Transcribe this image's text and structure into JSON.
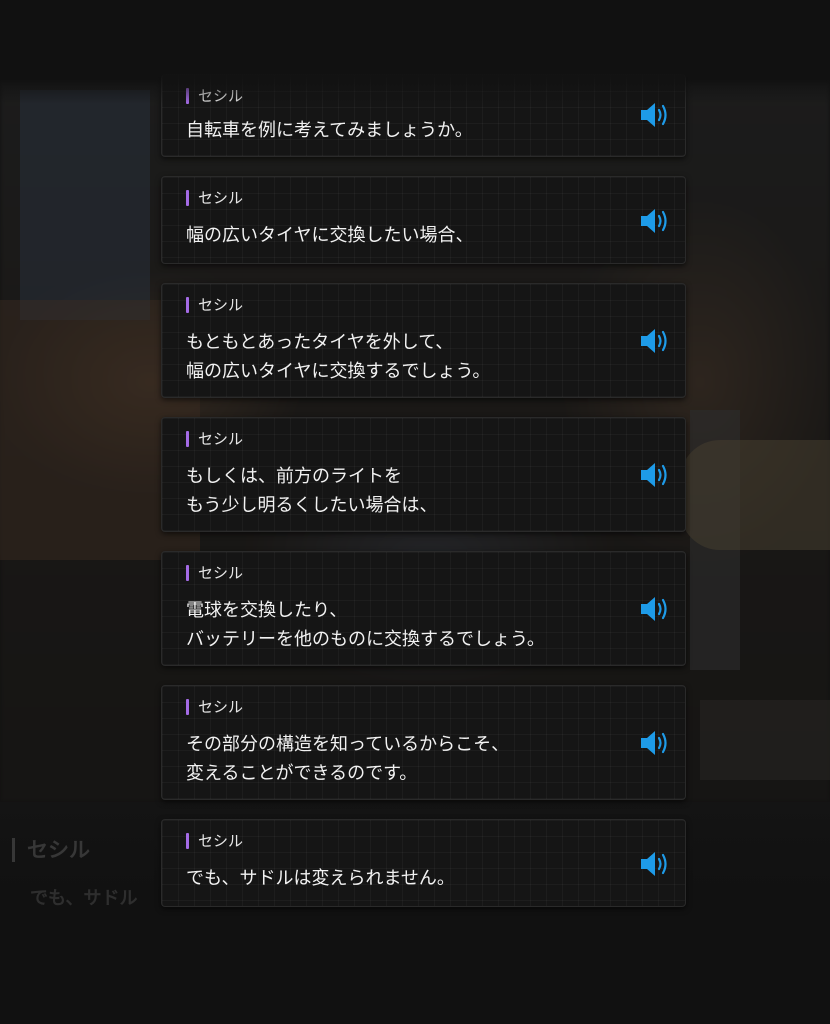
{
  "background": {
    "speaker_name": "セシル",
    "line_text": "でも、サドル"
  },
  "log": {
    "accent_color": "#a46be6",
    "voice_icon_color": "#1e9be8",
    "entries": [
      {
        "speaker": "セシル",
        "text": "自転車を例に考えてみましょうか。",
        "voice_icon": "speaker-volume-icon"
      },
      {
        "speaker": "セシル",
        "text": "幅の広いタイヤに交換したい場合、",
        "voice_icon": "speaker-volume-icon"
      },
      {
        "speaker": "セシル",
        "text": "もともとあったタイヤを外して、\n幅の広いタイヤに交換するでしょう。",
        "voice_icon": "speaker-volume-icon"
      },
      {
        "speaker": "セシル",
        "text": "もしくは、前方のライトを\nもう少し明るくしたい場合は、",
        "voice_icon": "speaker-volume-icon"
      },
      {
        "speaker": "セシル",
        "text": "電球を交換したり、\nバッテリーを他のものに交換するでしょう。",
        "voice_icon": "speaker-volume-icon"
      },
      {
        "speaker": "セシル",
        "text": "その部分の構造を知っているからこそ、\n変えることができるのです。",
        "voice_icon": "speaker-volume-icon"
      },
      {
        "speaker": "セシル",
        "text": "でも、サドルは変えられません。",
        "voice_icon": "speaker-volume-icon"
      }
    ]
  }
}
